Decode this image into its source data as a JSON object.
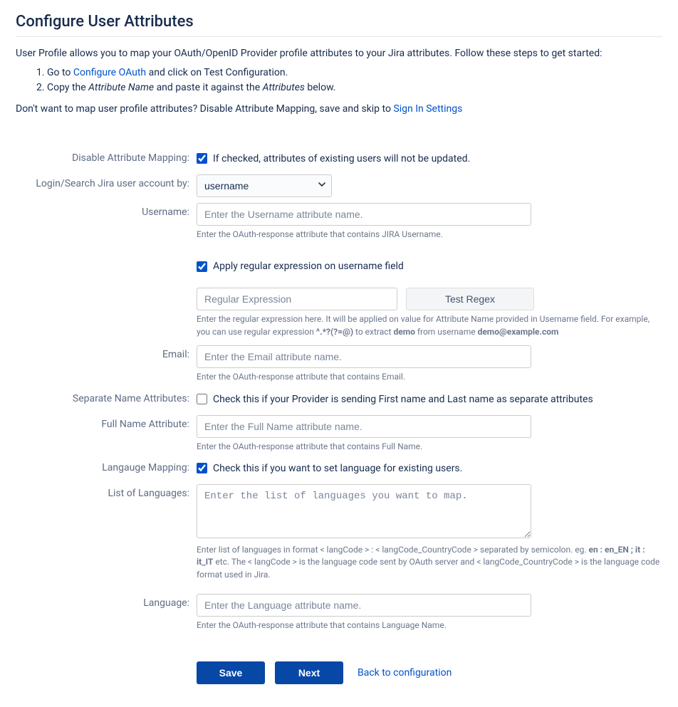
{
  "title": "Configure User Attributes",
  "intro": "User Profile allows you to map your OAuth/OpenID Provider profile attributes to your Jira attributes. Follow these steps to get started:",
  "steps": {
    "s1_pre": "Go to ",
    "s1_link": "Configure OAuth",
    "s1_post": " and click on Test Configuration.",
    "s2_pre": "Copy the ",
    "s2_em1": "Attribute Name",
    "s2_mid": " and paste it against the ",
    "s2_em2": "Attributes",
    "s2_post": " below."
  },
  "skip": {
    "pre": "Don't want to map user profile attributes? Disable Attribute Mapping, save and skip to ",
    "link": "Sign In Settings"
  },
  "labels": {
    "disable_mapping": "Disable Attribute Mapping:",
    "login_search": "Login/Search Jira user account by:",
    "username": "Username:",
    "email": "Email:",
    "separate_name": "Separate Name Attributes:",
    "full_name": "Full Name Attribute:",
    "lang_mapping": "Langauge Mapping:",
    "list_langs": "List of Languages:",
    "language": "Language:"
  },
  "controls": {
    "disable_mapping_chk": true,
    "disable_mapping_lbl": "If checked, attributes of existing users will not be updated.",
    "login_search_value": "username",
    "username_placeholder": "Enter the Username attribute name.",
    "username_help": "Enter the OAuth-response attribute that contains JIRA Username.",
    "regex_chk": true,
    "regex_chk_lbl": "Apply regular expression on username field",
    "regex_placeholder": "Regular Expression",
    "test_regex_btn": "Test Regex",
    "regex_help_pre": "Enter the regular expression here. It will be applied on value for Attribute Name provided in Username field. For example, you can use regular expression ",
    "regex_help_rx": "^.*?(?=@)",
    "regex_help_mid1": " to extract ",
    "regex_help_demo1": "demo",
    "regex_help_mid2": " from username ",
    "regex_help_demo2": "demo@example.com",
    "email_placeholder": "Enter the Email attribute name.",
    "email_help": "Enter the OAuth-response attribute that contains Email.",
    "sep_name_chk": false,
    "sep_name_lbl": "Check this if your Provider is sending First name and Last name as separate attributes",
    "fullname_placeholder": "Enter the Full Name attribute name.",
    "fullname_help": "Enter the OAuth-response attribute that contains Full Name.",
    "lang_map_chk": true,
    "lang_map_lbl": "Check this if you want to set language for existing users.",
    "list_langs_placeholder": "Enter the list of languages you want to map.",
    "list_langs_help_pre": "Enter list of languages in format < langCode > : < langCode_CountryCode > separated by semicolon. eg. ",
    "list_langs_help_eg": "en : en_EN ; it : it_IT",
    "list_langs_help_post": " etc. The < langCode > is the language code sent by OAuth server and < langCode_CountryCode > is the language code format used in Jira.",
    "language_placeholder": "Enter the Language attribute name.",
    "language_help": "Enter the OAuth-response attribute that contains Language Name."
  },
  "actions": {
    "save": "Save",
    "next": "Next",
    "back": "Back to configuration"
  }
}
